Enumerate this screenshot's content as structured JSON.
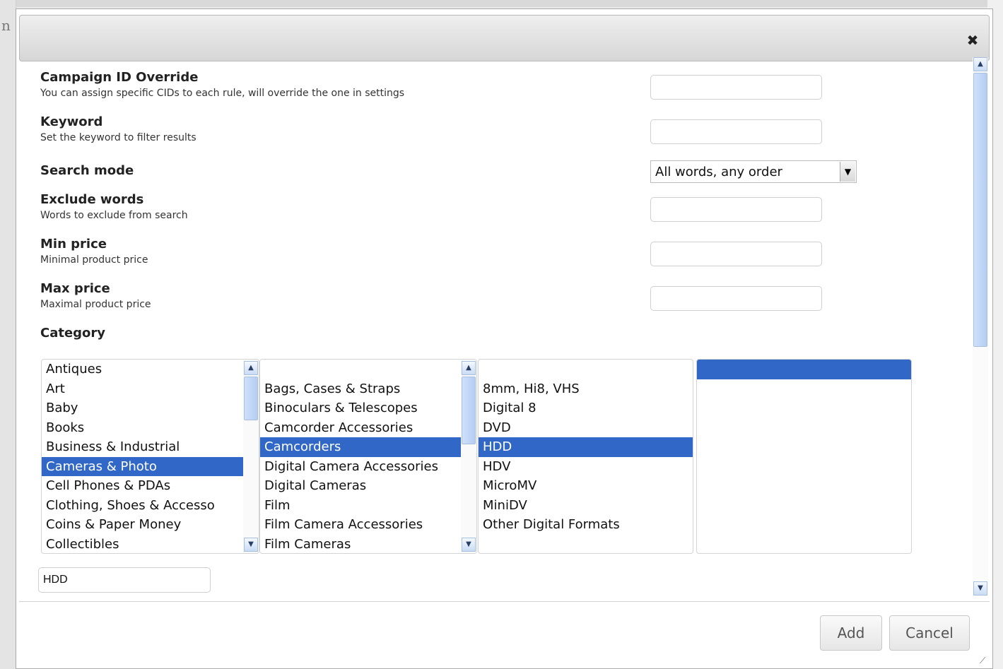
{
  "background": {
    "letter": "n"
  },
  "dialog": {
    "close_symbol": "✖",
    "fields": {
      "campaign": {
        "title": "Campaign ID Override",
        "desc": "You can assign specific CIDs to each rule, will override the one in settings",
        "value": ""
      },
      "keyword": {
        "title": "Keyword",
        "desc": "Set the keyword to filter results",
        "value": ""
      },
      "search_mode": {
        "title": "Search mode",
        "selected": "All words, any order"
      },
      "exclude": {
        "title": "Exclude words",
        "desc": "Words to exclude from search",
        "value": ""
      },
      "min_price": {
        "title": "Min price",
        "desc": "Minimal product price",
        "value": ""
      },
      "max_price": {
        "title": "Max price",
        "desc": "Maximal product price",
        "value": ""
      },
      "category": {
        "title": "Category"
      }
    },
    "category_lists": {
      "level1": [
        "Antiques",
        "Art",
        "Baby",
        "Books",
        "Business & Industrial",
        "Cameras & Photo",
        "Cell Phones & PDAs",
        "Clothing, Shoes & Accesso",
        "Coins & Paper Money",
        "Collectibles"
      ],
      "level1_selected": 5,
      "level2": [
        "",
        "Bags, Cases & Straps",
        "Binoculars & Telescopes",
        "Camcorder Accessories",
        "Camcorders",
        "Digital Camera Accessories",
        "Digital Cameras",
        "Film",
        "Film Camera Accessories",
        "Film Cameras"
      ],
      "level2_selected": 4,
      "level3": [
        "",
        "8mm, Hi8, VHS",
        "Digital 8",
        "DVD",
        "HDD",
        "HDV",
        "MicroMV",
        "MiniDV",
        "Other Digital Formats"
      ],
      "level3_selected": 4,
      "level4": [
        ""
      ],
      "level4_selected": 0
    },
    "selected_category_value": "HDD",
    "buttons": {
      "add": "Add",
      "cancel": "Cancel"
    },
    "colors": {
      "selection": "#3168c8"
    }
  }
}
